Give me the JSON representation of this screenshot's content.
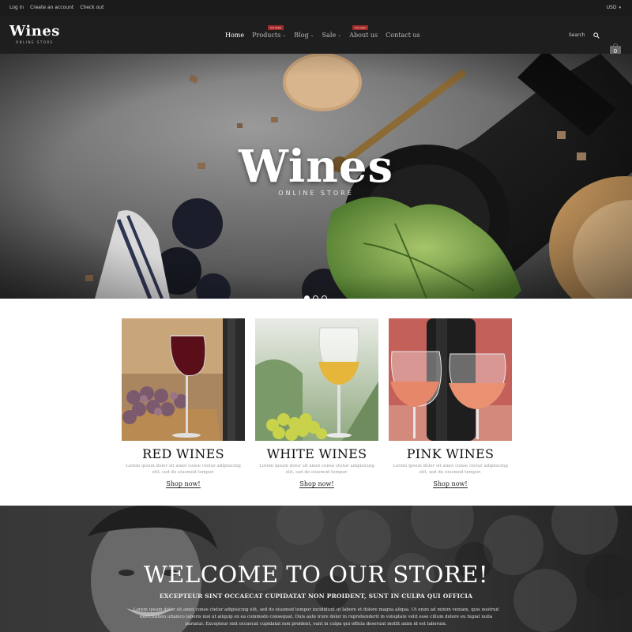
{
  "topbar": {
    "links": [
      "Log in",
      "Create an account",
      "Check out"
    ],
    "currency": "USD"
  },
  "header": {
    "logo_word": "Wines",
    "logo_tag": "ONLINE STORE",
    "nav": [
      {
        "label": "Home",
        "has_menu": false,
        "badge": ""
      },
      {
        "label": "Products",
        "has_menu": true,
        "badge": "hot deals"
      },
      {
        "label": "Blog",
        "has_menu": true,
        "badge": ""
      },
      {
        "label": "Sale",
        "has_menu": true,
        "badge": ""
      },
      {
        "label": "About us",
        "has_menu": false,
        "badge": "hot news"
      },
      {
        "label": "Contact us",
        "has_menu": false,
        "badge": ""
      }
    ],
    "search_label": "Search",
    "cart_count": "0"
  },
  "hero": {
    "title": "Wines",
    "subtitle": "ONLINE STORE",
    "slides": 3,
    "active_slide": 1
  },
  "categories": [
    {
      "name": "RED WINES",
      "description": "Lorem ipsum dolor sit amet conse ctetur adipisicing elit, sed do eiusmod tempor.",
      "link": "Shop now!",
      "image": "red-wine-glass-grapes"
    },
    {
      "name": "WHITE WINES",
      "description": "Lorem ipsum dolor sit amet conse ctetur adipisicing elit, sed do eiusmod tempor.",
      "link": "Shop now!",
      "image": "white-wine-glass-grapes"
    },
    {
      "name": "PINK WINES",
      "description": "Lorem ipsum dolor sit amet conse ctetur adipisicing elit, sed do eiusmod tempor.",
      "link": "Shop now!",
      "image": "pink-wine-glasses-bottle"
    }
  ],
  "welcome": {
    "title": "WELCOME TO OUR STORE!",
    "subtitle": "EXCEPTEUR SINT OCCAECAT CUPIDATAT NON PROIDENT, SUNT IN CULPA QUI OFFICIA",
    "body": "Lorem ipsum dolor sit amet conse ctetur adipisicing elit, sed do eiusmod tempor incididunt ut labore et dolore magna aliqua. Ut enim ad minim veniam, quis nostrud exercitation ullamco laboris nisi ut aliquip ex ea commodo consequat. Duis aute irure dolor in reprehenderit in voluptate velit esse cillum dolore eu fugiat nulla pariatur. Excepteur sint occaecat cupidatat non proident, sunt in culpa qui officia deserunt mollit anim id est laborum."
  },
  "colors": {
    "topbar_bg": "#1b1b1b",
    "header_bg": "#1e1e1e",
    "badge": "#a52a2a",
    "page_bg": "#ffffff"
  }
}
